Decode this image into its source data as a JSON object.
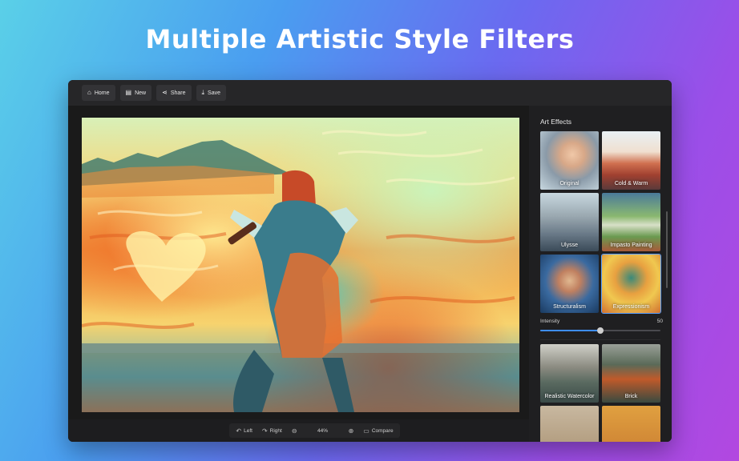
{
  "headline": "Multiple Artistic Style Filters",
  "toolbar": {
    "home_label": "Home",
    "new_label": "New",
    "share_label": "Share",
    "save_label": "Save"
  },
  "bottom_bar": {
    "left_label": "Left",
    "right_label": "Right",
    "zoom": "44%",
    "compare_label": "Compare"
  },
  "sidebar": {
    "title": "Art Effects",
    "effects": [
      {
        "label": "Original"
      },
      {
        "label": "Cold & Warm"
      },
      {
        "label": "Ulysse"
      },
      {
        "label": "Impasto Painting"
      },
      {
        "label": "Structuralism"
      },
      {
        "label": "Expressionism"
      }
    ],
    "intensity_label": "Intensity",
    "intensity_value": "50",
    "intensity_fraction": 0.5,
    "more_effects": [
      {
        "label": "Realistic Watercolor"
      },
      {
        "label": "Brick"
      },
      {
        "label": ""
      },
      {
        "label": ""
      }
    ]
  },
  "colors": {
    "accent": "#3e8ef7",
    "window_bg": "#1d1d1f",
    "toolbar_bg": "#262628"
  },
  "icons": [
    "home-icon",
    "new-file-icon",
    "share-icon",
    "download-icon",
    "rotate-left-icon",
    "rotate-right-icon",
    "zoom-out-icon",
    "zoom-in-icon",
    "compare-icon"
  ]
}
